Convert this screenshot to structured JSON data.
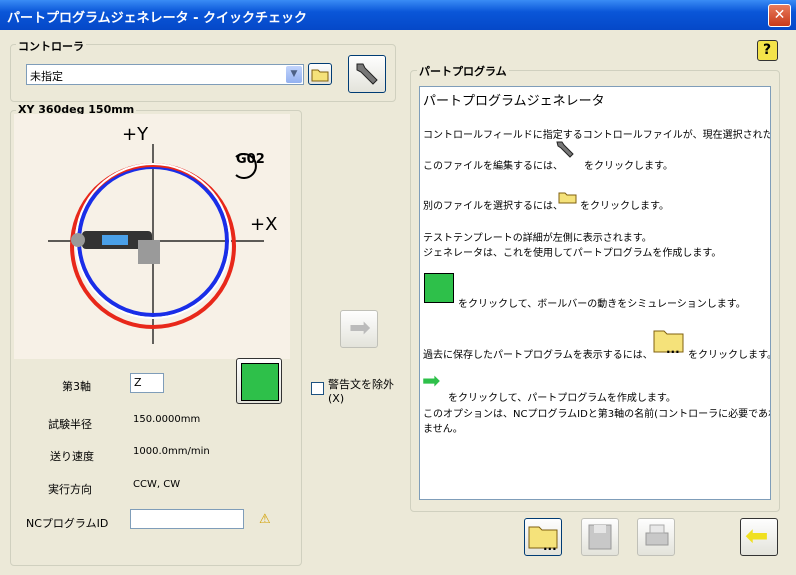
{
  "window": {
    "title": "パートプログラムジェネレータ - クイックチェック",
    "close": "✕"
  },
  "help": {
    "label": "?"
  },
  "controller": {
    "group_label": "コントローラ",
    "selected": "未指定"
  },
  "plot": {
    "group_label": "XY 360deg 150mm",
    "y_axis": "+Y",
    "x_axis": "+X",
    "gcode": "G02",
    "colors": {
      "blue": "#1a2ee8",
      "red": "#e8281a"
    }
  },
  "params": {
    "axis3_label": "第3軸",
    "axis3_value": "Z",
    "radius_label": "試験半径",
    "radius_value": "150.0000mm",
    "feed_label": "送り速度",
    "feed_value": "1000.0mm/min",
    "dir_label": "実行方向",
    "dir_value": "CCW, CW",
    "ncid_label": "NCプログラムID",
    "ncid_value": ""
  },
  "warn_checkbox": {
    "label": "警告文を除外(X)"
  },
  "part_program": {
    "group_label": "パートプログラム",
    "lines": {
      "title": "パートプログラムジェネレータ",
      "l1": "コントロールフィールドに指定するコントロールファイルが、現在選択されたもの",
      "l2": "このファイルを編集するには、",
      "l2b": "をクリックします。",
      "l3": "別のファイルを選択するには、",
      "l3b": "をクリックします。",
      "l4": "テストテンプレートの詳細が左側に表示されます。",
      "l5": "ジェネレータは、これを使用してパートプログラムを作成します。",
      "l6": "をクリックして、ボールバーの動きをシミュレーションします。",
      "l7": "過去に保存したパートプログラムを表示するには、",
      "l7b": "をクリックします。",
      "l8": "をクリックして、パートプログラムを作成します。",
      "l9": "このオプションは、NCプログラムIDと第3軸の名前(コントローラに必要であれば",
      "l10": "ません。"
    }
  },
  "dots": "..."
}
